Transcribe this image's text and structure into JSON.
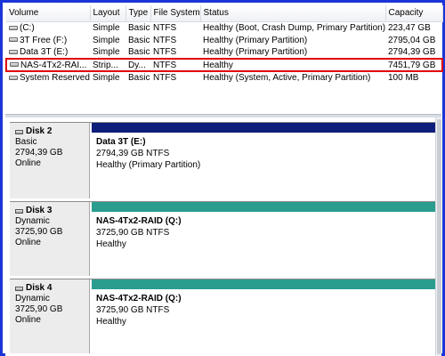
{
  "volumes": {
    "headers": {
      "volume": "Volume",
      "layout": "Layout",
      "type": "Type",
      "fs": "File System",
      "status": "Status",
      "capacity": "Capacity"
    },
    "rows": [
      {
        "volume": "(C:)",
        "layout": "Simple",
        "type": "Basic",
        "fs": "NTFS",
        "status": "Healthy (Boot, Crash Dump, Primary Partition)",
        "capacity": "223,47 GB"
      },
      {
        "volume": "3T Free (F:)",
        "layout": "Simple",
        "type": "Basic",
        "fs": "NTFS",
        "status": "Healthy (Primary Partition)",
        "capacity": "2795,04 GB"
      },
      {
        "volume": "Data 3T (E:)",
        "layout": "Simple",
        "type": "Basic",
        "fs": "NTFS",
        "status": "Healthy (Primary Partition)",
        "capacity": "2794,39 GB"
      },
      {
        "volume": "NAS-4Tx2-RAI...",
        "layout": "Strip...",
        "type": "Dy...",
        "fs": "NTFS",
        "status": "Healthy",
        "capacity": "7451,79 GB"
      },
      {
        "volume": "System Reserved",
        "layout": "Simple",
        "type": "Basic",
        "fs": "NTFS",
        "status": "Healthy (System, Active, Primary Partition)",
        "capacity": "100 MB"
      }
    ],
    "highlight_color": "#e00000"
  },
  "disks": [
    {
      "name": "Disk 2",
      "type": "Basic",
      "size": "2794,39 GB",
      "state": "Online",
      "partition": {
        "name": "Data 3T  (E:)",
        "size": "2794,39 GB NTFS",
        "status": "Healthy (Primary Partition)",
        "bar_color": "#0d1f7a"
      }
    },
    {
      "name": "Disk 3",
      "type": "Dynamic",
      "size": "3725,90 GB",
      "state": "Online",
      "partition": {
        "name": "NAS-4Tx2-RAID  (Q:)",
        "size": "3725,90 GB NTFS",
        "status": "Healthy",
        "bar_color": "#2a9d8f"
      }
    },
    {
      "name": "Disk 4",
      "type": "Dynamic",
      "size": "3725,90 GB",
      "state": "Online",
      "partition": {
        "name": "NAS-4Tx2-RAID  (Q:)",
        "size": "3725,90 GB NTFS",
        "status": "Healthy",
        "bar_color": "#2a9d8f"
      }
    }
  ],
  "icons": {
    "volume": "volume-drive-icon",
    "disk": "disk-drive-icon"
  }
}
